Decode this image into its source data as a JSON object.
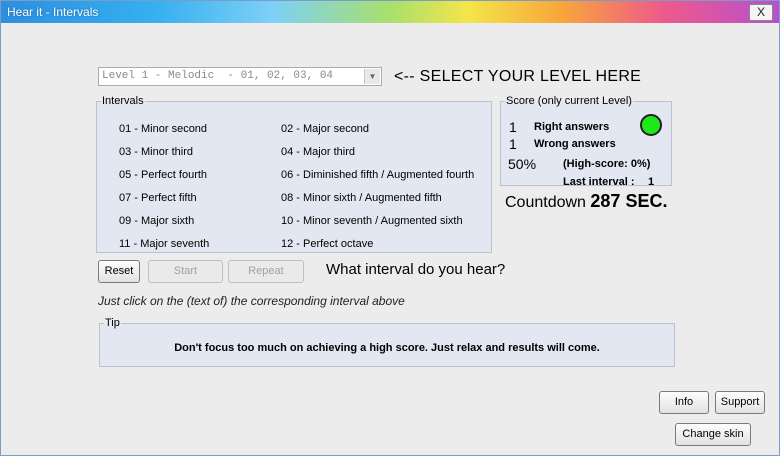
{
  "window": {
    "title": "Hear it - Intervals",
    "close_label": "X"
  },
  "level": {
    "selected": "Level 1 - Melodic  - 01, 02, 03, 04",
    "hint": "<-- SELECT YOUR LEVEL HERE"
  },
  "intervals": {
    "legend": "Intervals",
    "items": [
      "01 - Minor second",
      "02 - Major second",
      "03 - Minor third",
      "04 - Major third",
      "05 - Perfect fourth",
      "06 - Diminished fifth / Augmented fourth",
      "07 - Perfect fifth",
      "08 - Minor sixth / Augmented fifth",
      "09 - Major sixth",
      "10 - Minor seventh / Augmented sixth",
      "11 - Major seventh",
      "12 - Perfect octave"
    ]
  },
  "score": {
    "legend": "Score (only current Level)",
    "right_count": "1",
    "right_label": "Right answers",
    "wrong_count": "1",
    "wrong_label": "Wrong answers",
    "percent": "50%",
    "highscore": "(High-score: 0%)",
    "last_label": "Last interval :",
    "last_value": "1",
    "status_color": "#1ee81a"
  },
  "countdown": {
    "label": "Countdown",
    "value": "287 SEC."
  },
  "buttons": {
    "reset": "Reset",
    "start": "Start",
    "repeat": "Repeat",
    "info": "Info",
    "support": "Support",
    "change_skin": "Change skin"
  },
  "question": "What interval do you hear?",
  "instruction": "Just click on the (text of) the corresponding interval above",
  "tip": {
    "legend": "Tip",
    "text": "Don't focus too much on achieving a high score. Just relax and results will come."
  }
}
